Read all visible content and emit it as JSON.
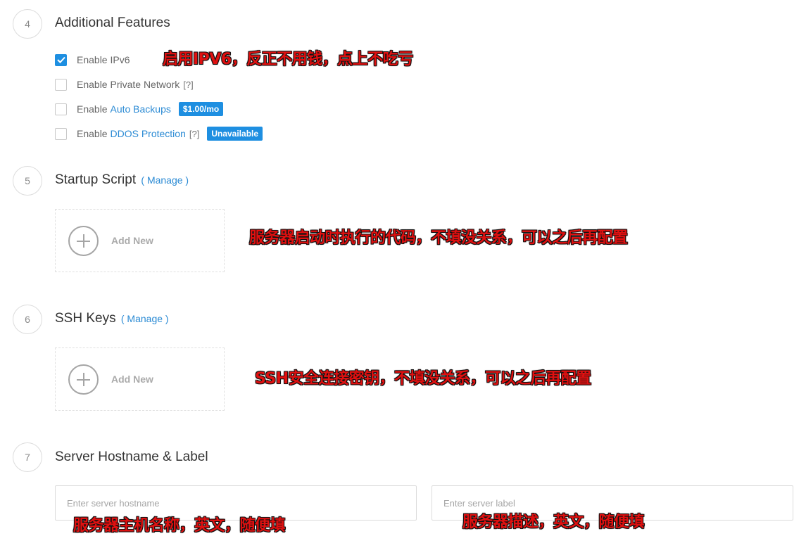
{
  "sections": {
    "features": {
      "number": "4",
      "title": "Additional Features"
    },
    "startup": {
      "number": "5",
      "title": "Startup Script",
      "manage": "( Manage )",
      "add_label": "Add New"
    },
    "ssh": {
      "number": "6",
      "title": "SSH Keys",
      "manage": "( Manage )",
      "add_label": "Add New"
    },
    "hostname": {
      "number": "7",
      "title": "Server Hostname & Label"
    }
  },
  "features": {
    "ipv6": {
      "label": "Enable IPv6",
      "checked": true
    },
    "private_network": {
      "label": "Enable Private Network",
      "help": "[?]",
      "checked": false
    },
    "auto_backups": {
      "prefix": "Enable ",
      "link": "Auto Backups",
      "badge": "$1.00/mo",
      "checked": false
    },
    "ddos": {
      "prefix": "Enable ",
      "link": "DDOS Protection",
      "help": "[?]",
      "badge": "Unavailable",
      "checked": false
    }
  },
  "inputs": {
    "hostname": {
      "placeholder": "Enter server hostname",
      "value": ""
    },
    "label": {
      "placeholder": "Enter server label",
      "value": ""
    }
  },
  "annotations": {
    "ipv6": "启用IPV6，反正不用钱，点上不吃亏",
    "startup": "服务器启动时执行的代码，不填没关系，可以之后再配置",
    "ssh": "SSH安全连接密钥，不填没关系，可以之后再配置",
    "hostname": "服务器主机名称，英文，随便填",
    "label": "服务器描述，英文，随便填"
  },
  "colors": {
    "accent": "#1e8fe1",
    "link": "#2a8ad4",
    "annotation_text": "#e01010",
    "annotation_outline": "#111111"
  }
}
